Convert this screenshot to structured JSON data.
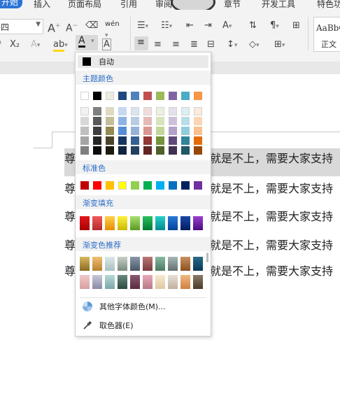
{
  "ribbon": {
    "tabs": [
      "开始",
      "插入",
      "页面布局",
      "引用",
      "审阅",
      "章节",
      "开发工具",
      "特色功"
    ],
    "font_size_value": "四",
    "style_preview": "AaBbC",
    "style_name": "正文",
    "phonetic_label": "wén",
    "char_a": "A",
    "highlight_label": "ab"
  },
  "document": {
    "lines": [
      "尊",
      "尊",
      "尊",
      "尊",
      "尊"
    ],
    "lines_right": [
      "就是不上，需要大家支持",
      "就是不上，需要大家支持",
      "就是不上，需要大家支持",
      "就是不上，需要大家支持",
      "就是不上，需要大家支持"
    ]
  },
  "color_menu": {
    "auto_label": "自动",
    "theme_label": "主题颜色",
    "standard_label": "标准色",
    "gradient_fill_label": "渐变填充",
    "gradient_recommend_label": "渐变色推荐",
    "more_colors_label": "其他字体颜色(M)...",
    "picker_label": "取色器(E)",
    "theme_top": [
      "#ffffff",
      "#000000",
      "#eeece1",
      "#1f497d",
      "#4f81bd",
      "#c0504d",
      "#9bbb59",
      "#8064a2",
      "#4bacc6",
      "#f79646"
    ],
    "theme_grid": [
      [
        "#f2f2f2",
        "#7f7f7f",
        "#ddd9c3",
        "#c6d9f0",
        "#dbe5f1",
        "#f2dcdb",
        "#ebf1dd",
        "#e5e0ec",
        "#dbeef3",
        "#fdeada"
      ],
      [
        "#d8d8d8",
        "#595959",
        "#c4bd97",
        "#8db3e2",
        "#b8cce4",
        "#e5b9b7",
        "#d7e3bc",
        "#ccc1d9",
        "#b7dde8",
        "#fbd5b5"
      ],
      [
        "#bfbfbf",
        "#3f3f3f",
        "#938953",
        "#548dd4",
        "#95b3d7",
        "#d99694",
        "#c3d69b",
        "#b2a2c7",
        "#92cddc",
        "#fac08f"
      ],
      [
        "#a5a5a5",
        "#262626",
        "#494429",
        "#17365d",
        "#366092",
        "#953734",
        "#76923c",
        "#5f497a",
        "#31859b",
        "#e36c09"
      ],
      [
        "#7f7f7f",
        "#0c0c0c",
        "#1d1b10",
        "#0f243e",
        "#244061",
        "#632423",
        "#4f6128",
        "#3f3151",
        "#205867",
        "#974806"
      ]
    ],
    "standard": [
      "#c00000",
      "#ff0000",
      "#ffc000",
      "#ffff00",
      "#92d050",
      "#00b050",
      "#00b0f0",
      "#0070c0",
      "#002060",
      "#7030a0"
    ],
    "gradient_fill": [
      [
        "#e0191f",
        "#a80000"
      ],
      [
        "#f05a5a",
        "#b52a2a"
      ],
      [
        "#ffd24a",
        "#e58a00"
      ],
      [
        "#fff23a",
        "#c8b800"
      ],
      [
        "#a8e070",
        "#5a9a20"
      ],
      [
        "#2cc060",
        "#007a30"
      ],
      [
        "#2ad0c8",
        "#008a90"
      ],
      [
        "#2a7ad8",
        "#003f99"
      ],
      [
        "#1a4aa8",
        "#001a60"
      ],
      [
        "#9a40d0",
        "#4a0a80"
      ]
    ],
    "gradient_recommend": [
      [
        [
          "#d8b860",
          "#8a6a20"
        ],
        [
          "#f0c070",
          "#b88030"
        ],
        [
          "#dce8e8",
          "#a8c0c0"
        ],
        [
          "#c8d0c8",
          "#7a8a80"
        ],
        [
          "#8898a8",
          "#4a5868"
        ],
        [
          "#b87878",
          "#7a3a3a"
        ],
        [
          "#88b8a0",
          "#4a7a60"
        ],
        [
          "#a8b8b8",
          "#607070"
        ],
        [
          "#c89060",
          "#8a5020"
        ],
        [
          "#2a6a88",
          "#0a3a58"
        ]
      ],
      [
        [
          "#f0c8c8",
          "#d8a0a0"
        ],
        [
          "#c8c8d8",
          "#8a8aa8"
        ],
        [
          "#b8d8d8",
          "#7aa8a8"
        ],
        [
          "#6a8a80",
          "#2a4a40"
        ],
        [
          "#8a5a70",
          "#5a2a40"
        ],
        [
          "#e8a8b8",
          "#b87888"
        ],
        [
          "#f8e8d0",
          "#e0c8a0"
        ],
        [
          "#e8e0d8",
          "#c0b0a0"
        ],
        [
          "#f0b880",
          "#d08040"
        ],
        [
          "#8a7a68",
          "#4a3a28"
        ]
      ]
    ]
  }
}
